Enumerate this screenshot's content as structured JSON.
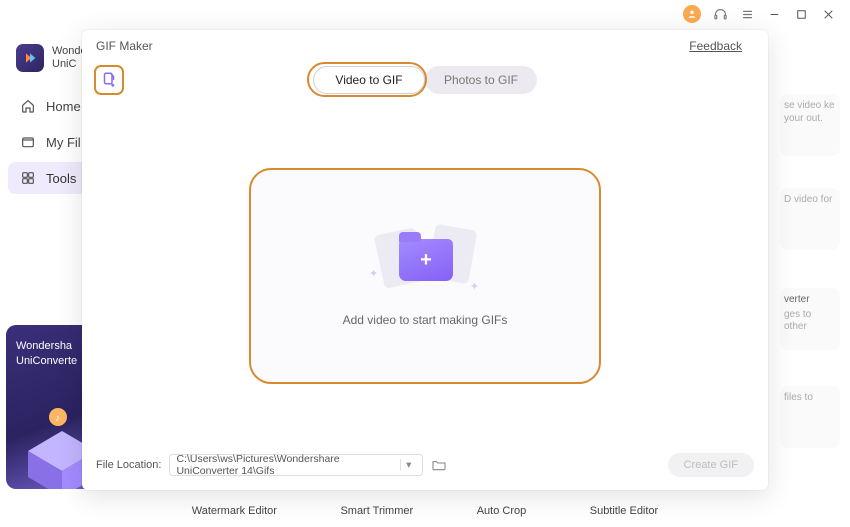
{
  "titlebar": {
    "avatar": "user-avatar"
  },
  "sidebar": {
    "brand_line1": "Wonde",
    "brand_line2": "UniC",
    "items": [
      {
        "label": "Home"
      },
      {
        "label": "My Fil"
      },
      {
        "label": "Tools"
      }
    ]
  },
  "promo": {
    "line1": "Wondersha",
    "line2": "UniConverte"
  },
  "bg_cards": [
    {
      "title": "",
      "snippet": "se video\nke your\nout."
    },
    {
      "title": "",
      "snippet": "D video for"
    },
    {
      "title": "verter",
      "snippet": "ges to other"
    },
    {
      "title": "",
      "snippet": "files to"
    }
  ],
  "footer_tools": [
    "Watermark Editor",
    "Smart Trimmer",
    "Auto Crop",
    "Subtitle Editor"
  ],
  "modal": {
    "title": "GIF Maker",
    "feedback": "Feedback",
    "tabs": {
      "active": "Video to GIF",
      "inactive": "Photos to GIF"
    },
    "drop_instruction": "Add video to start making GIFs",
    "file_location_label": "File Location:",
    "file_location_path": "C:\\Users\\ws\\Pictures\\Wondershare UniConverter 14\\Gifs",
    "create_button": "Create GIF"
  }
}
